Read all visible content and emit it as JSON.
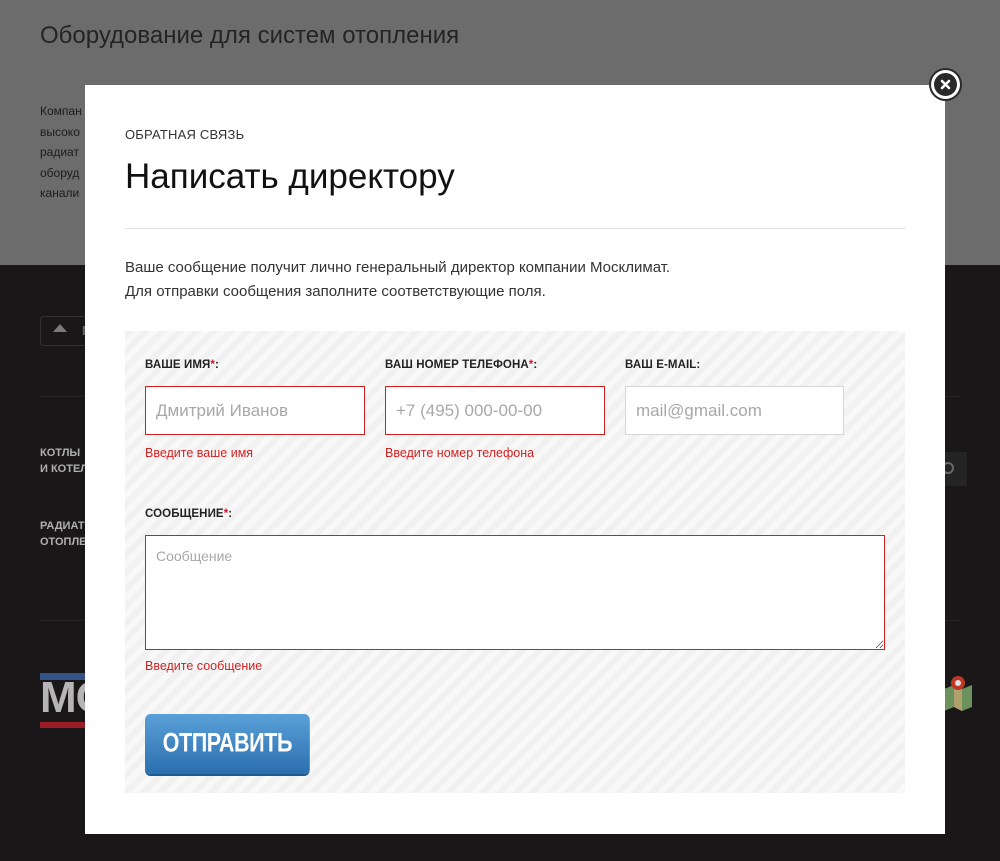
{
  "background": {
    "heading": "Оборудование для систем отопления",
    "paragraph_lines": [
      "Компан",
      "высоко",
      "радиат",
      "оборуд",
      "канали"
    ],
    "trailing_dash": "-",
    "up_button_text": "П",
    "categories": [
      "КОТЛЫ\nИ КОТЕЛ",
      "РАДИАТ\nОТОПЛЕ"
    ],
    "logo_text": "МО"
  },
  "modal": {
    "eyebrow": "ОБРАТНАЯ СВЯЗЬ",
    "title": "Написать директору",
    "description": [
      "Ваше сообщение получит лично генеральный директор компании Москлимат.",
      "Для отправки сообщения заполните соответствующие поля."
    ],
    "close_icon": "close-x-icon"
  },
  "form": {
    "name": {
      "label": "ВАШЕ ИМЯ",
      "required_mark": "*",
      "colon": ":",
      "placeholder": "Дмитрий Иванов",
      "value": "",
      "error": "Введите ваше имя"
    },
    "phone": {
      "label": "ВАШ НОМЕР ТЕЛЕФОНА",
      "required_mark": "*",
      "colon": ":",
      "placeholder": "+7 (495) 000-00-00",
      "value": "",
      "error": "Введите номер телефона"
    },
    "email": {
      "label": "ВАШ E-MAIL:",
      "placeholder": "mail@gmail.com",
      "value": ""
    },
    "message": {
      "label": "СООБЩЕНИЕ",
      "required_mark": "*",
      "colon": ":",
      "placeholder": "Сообщение",
      "value": "",
      "error": "Введите сообщение"
    },
    "submit_label": "ОТПРАВИТЬ"
  },
  "colors": {
    "error": "#d32222",
    "button": "#2a6fae",
    "overlay_top": "#7c7c7c",
    "footer": "#1d1b1b"
  }
}
